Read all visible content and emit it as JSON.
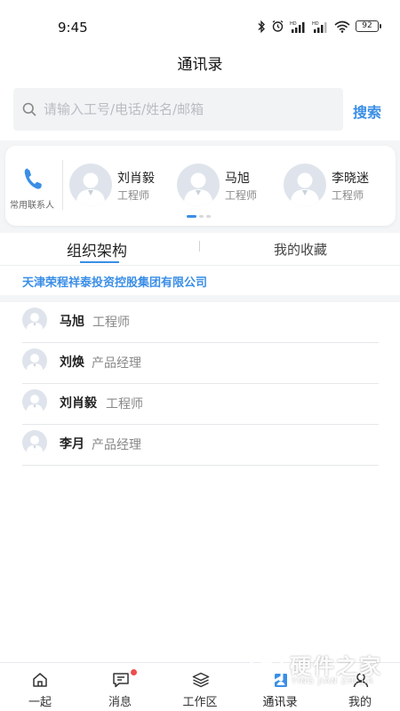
{
  "status_bar": {
    "time": "9:45",
    "battery": "92",
    "icons": [
      "bluetooth-icon",
      "alarm-icon",
      "signal-hd-icon",
      "signal-hd-icon",
      "wifi-icon",
      "battery-icon"
    ]
  },
  "header": {
    "title": "通讯录"
  },
  "search": {
    "placeholder": "请输入工号/电话/姓名/邮箱",
    "button_label": "搜索"
  },
  "frequent_contacts": {
    "label": "常用联系人",
    "icon": "phone-icon",
    "people": [
      {
        "name": "刘肖毅",
        "title": "工程师"
      },
      {
        "name": "马旭",
        "title": "工程师"
      },
      {
        "name": "李晓迷",
        "title": "工程师"
      }
    ],
    "page_count": 3,
    "active_page": 1
  },
  "tabs": [
    {
      "label": "组织架构",
      "active": true
    },
    {
      "label": "我的收藏",
      "active": false
    }
  ],
  "company": "天津荣程祥泰投资控股集团有限公司",
  "members": [
    {
      "name": "马旭",
      "title": "工程师"
    },
    {
      "name": "刘焕",
      "title": "产品经理"
    },
    {
      "name": "刘肖毅",
      "title": "工程师"
    },
    {
      "name": "李月",
      "title": "产品经理"
    }
  ],
  "bottom_nav": [
    {
      "label": "一起",
      "icon": "home-icon"
    },
    {
      "label": "消息",
      "icon": "message-icon",
      "badge": true
    },
    {
      "label": "工作区",
      "icon": "layers-icon"
    },
    {
      "label": "通讯录",
      "icon": "contacts-icon",
      "active": true
    },
    {
      "label": "我的",
      "icon": "profile-icon"
    }
  ],
  "watermark": {
    "text": "硬件之家",
    "subtext": "YING JIAN ZHI JIA"
  },
  "colors": {
    "accent": "#3a8ee6",
    "badge": "#ee4d4d",
    "background_band": "#f4f5f7"
  }
}
